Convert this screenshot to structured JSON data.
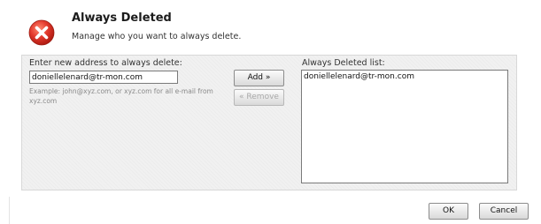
{
  "header": {
    "title": "Always Deleted",
    "subtitle": "Manage who you want to always delete.",
    "icon": "error-x-icon",
    "icon_color": "#e2382c"
  },
  "form": {
    "new_address_label": "Enter new address to always delete:",
    "new_address_value": "doniellelenard@tr-mon.com",
    "example_text": "Example: john@xyz.com, or xyz.com for all e-mail from xyz.com",
    "add_button": "Add »",
    "remove_button": "« Remove",
    "remove_disabled": true
  },
  "list": {
    "label": "Always Deleted list:",
    "items": [
      "doniellelenard@tr-mon.com"
    ]
  },
  "footer": {
    "ok_button": "OK",
    "cancel_button": "Cancel"
  }
}
